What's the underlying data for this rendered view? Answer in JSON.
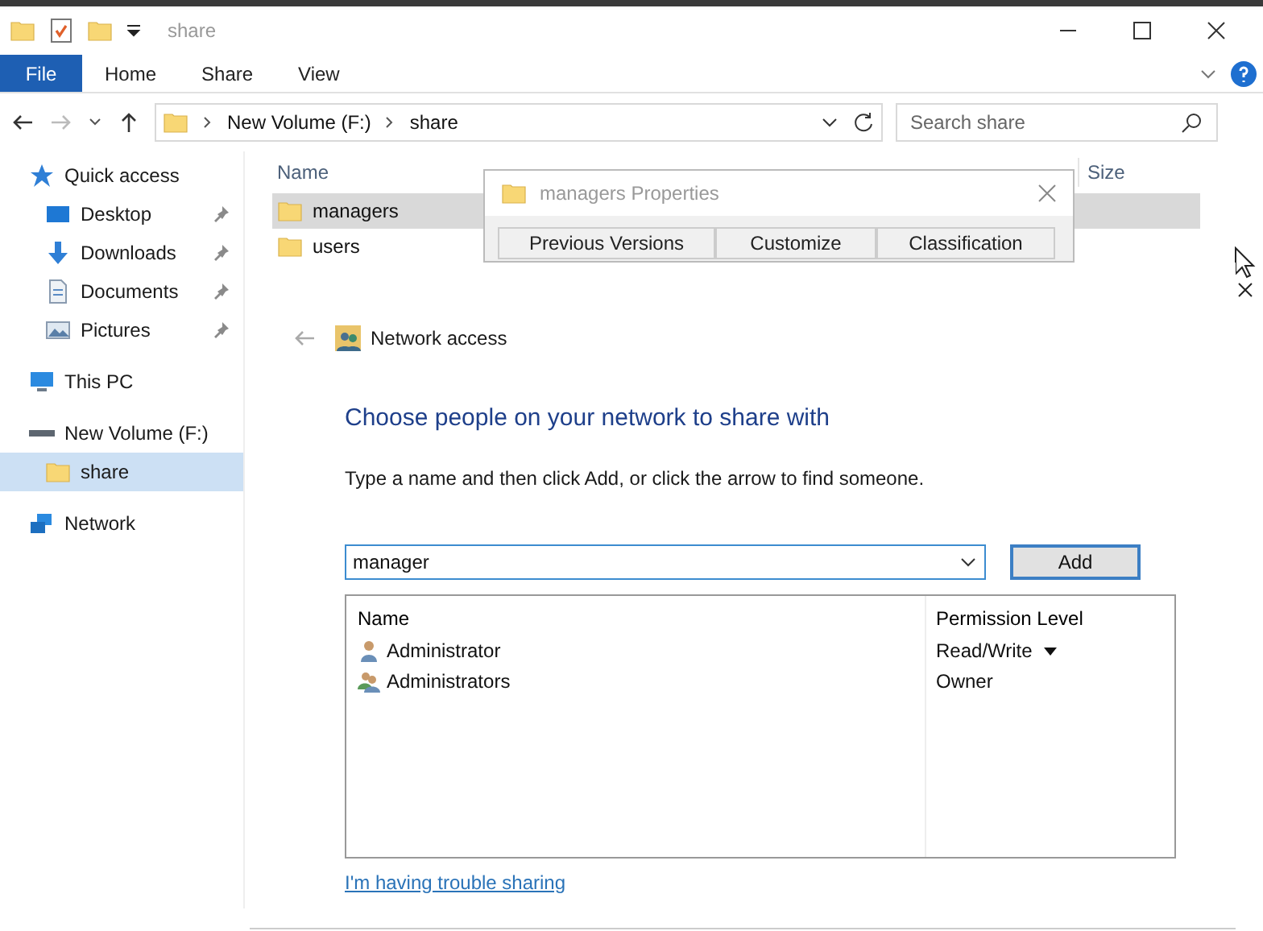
{
  "window": {
    "title": "share"
  },
  "ribbon_tabs": [
    {
      "label": "File",
      "kind": "file"
    },
    {
      "label": "Home",
      "kind": "tab"
    },
    {
      "label": "Share",
      "kind": "tab"
    },
    {
      "label": "View",
      "kind": "tab"
    }
  ],
  "address_bar": {
    "path": [
      "New Volume (F:)",
      "share"
    ]
  },
  "search": {
    "placeholder": "Search share"
  },
  "sidebar": {
    "items": [
      {
        "label": "Quick access",
        "kind": "star",
        "selected": false,
        "children": [
          {
            "label": "Desktop",
            "kind": "desktop",
            "pinned": true,
            "selected": false
          },
          {
            "label": "Downloads",
            "kind": "download",
            "pinned": true,
            "selected": false
          },
          {
            "label": "Documents",
            "kind": "document",
            "pinned": true,
            "selected": false
          },
          {
            "label": "Pictures",
            "kind": "picture",
            "pinned": true,
            "selected": false
          }
        ]
      },
      {
        "label": "This PC",
        "kind": "pc",
        "selected": false
      },
      {
        "label": "New Volume (F:)",
        "kind": "drive",
        "selected": false,
        "children": [
          {
            "label": "share",
            "kind": "folder",
            "pinned": false,
            "selected": true
          }
        ]
      },
      {
        "label": "Network",
        "kind": "network",
        "selected": false
      }
    ]
  },
  "file_list": {
    "columns": [
      "Name",
      "Size"
    ],
    "rows": [
      {
        "name": "managers",
        "selected": true
      },
      {
        "name": "users",
        "selected": false
      }
    ]
  },
  "properties_dialog": {
    "title": "managers Properties",
    "tabs": [
      "Previous Versions",
      "Customize",
      "Classification"
    ]
  },
  "share_dialog": {
    "title": "Network access",
    "heading": "Choose people on your network to share with",
    "instruction": "Type a name and then click Add, or click the arrow to find someone.",
    "name_input": {
      "value": "manager"
    },
    "add_button": "Add",
    "columns": [
      "Name",
      "Permission Level"
    ],
    "rows": [
      {
        "name": "Administrator",
        "kind": "user",
        "permission": "Read/Write",
        "has_menu": true
      },
      {
        "name": "Administrators",
        "kind": "group",
        "permission": "Owner",
        "has_menu": false
      }
    ],
    "help_link": "I'm having trouble sharing"
  }
}
